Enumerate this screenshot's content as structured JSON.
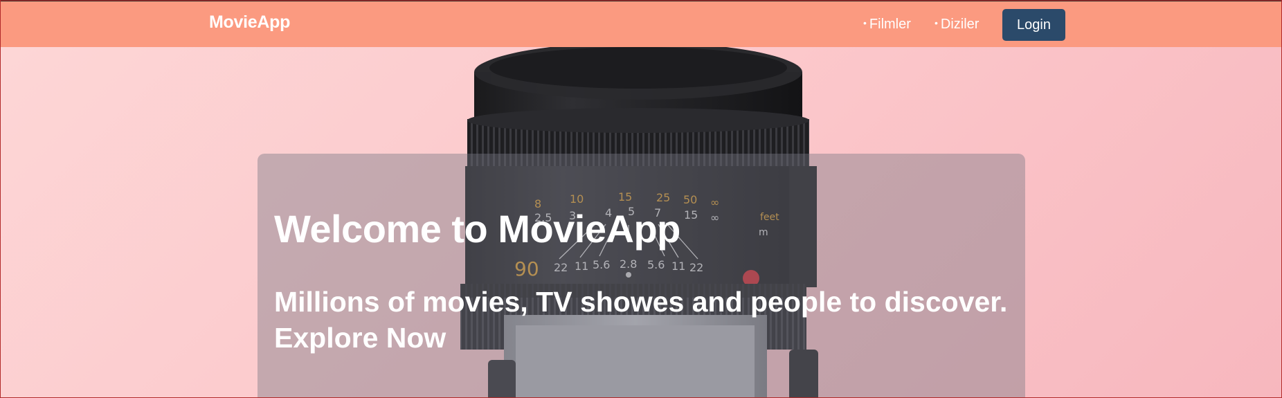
{
  "navbar": {
    "brand": "MovieApp",
    "links": [
      {
        "bullet": "•",
        "label": "Filmler"
      },
      {
        "bullet": "•",
        "label": "Diziler"
      }
    ],
    "login_label": "Login",
    "bg_color": "#fb9a80",
    "login_color": "#2b4a6a"
  },
  "hero": {
    "title": "Welcome to MovieApp",
    "subtitle_line1": "Millions of movies, TV showes and people to discover.",
    "subtitle_line2": "Explore Now",
    "image": "camera-lens-photo",
    "lens_markings": {
      "top_row": [
        "8",
        "10",
        "15",
        "25",
        "50",
        "∞"
      ],
      "second_row": [
        "2.5",
        "3",
        "4",
        "5",
        "7",
        "15",
        "∞"
      ],
      "aperture_row": [
        "22",
        "11",
        "5.6",
        "2.8",
        "5.6",
        "11",
        "22"
      ],
      "focal": "90",
      "unit_feet": "feet",
      "unit_m": "m"
    }
  }
}
